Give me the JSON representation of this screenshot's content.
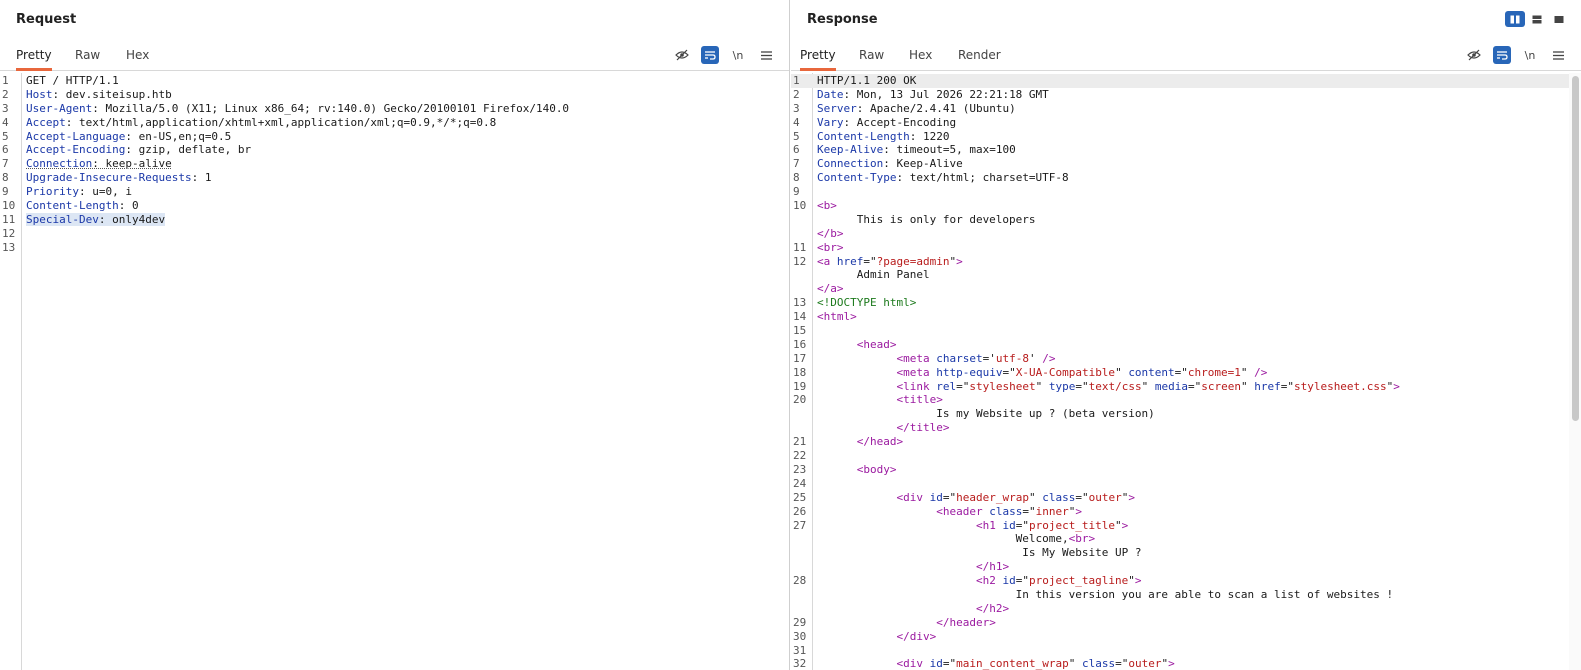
{
  "request": {
    "title": "Request",
    "tabs": [
      "Pretty",
      "Raw",
      "Hex"
    ],
    "active_tab": "Pretty",
    "lines": [
      {
        "n": "1",
        "segs": [
          {
            "t": "GET / HTTP/1.1",
            "c": ""
          }
        ]
      },
      {
        "n": "2",
        "segs": [
          {
            "t": "Host",
            "c": "hk"
          },
          {
            "t": ": dev.siteisup.htb",
            "c": ""
          }
        ]
      },
      {
        "n": "3",
        "segs": [
          {
            "t": "User-Agent",
            "c": "hk"
          },
          {
            "t": ": Mozilla/5.0 (X11; Linux x86_64; rv:140.0) Gecko/20100101 Firefox/140.0",
            "c": ""
          }
        ]
      },
      {
        "n": "4",
        "segs": [
          {
            "t": "Accept",
            "c": "hk"
          },
          {
            "t": ": text/html,application/xhtml+xml,application/xml;q=0.9,*/*;q=0.8",
            "c": ""
          }
        ]
      },
      {
        "n": "5",
        "segs": [
          {
            "t": "Accept-Language",
            "c": "hk"
          },
          {
            "t": ": en-US,en;q=0.5",
            "c": ""
          }
        ]
      },
      {
        "n": "6",
        "segs": [
          {
            "t": "Accept-Encoding",
            "c": "hk"
          },
          {
            "t": ": gzip, deflate, br",
            "c": ""
          }
        ]
      },
      {
        "n": "7",
        "segs": [
          {
            "t": "Connection",
            "c": "hk ul"
          },
          {
            "t": ": keep-alive",
            "c": "ul"
          }
        ]
      },
      {
        "n": "8",
        "segs": [
          {
            "t": "Upgrade-Insecure-Requests",
            "c": "hk"
          },
          {
            "t": ": 1",
            "c": ""
          }
        ]
      },
      {
        "n": "9",
        "segs": [
          {
            "t": "Priority",
            "c": "hk"
          },
          {
            "t": ": u=0, i",
            "c": ""
          }
        ]
      },
      {
        "n": "10",
        "segs": [
          {
            "t": "Content-Length",
            "c": "hk"
          },
          {
            "t": ": 0",
            "c": ""
          }
        ]
      },
      {
        "n": "11",
        "segs": [
          {
            "t": "Special-Dev",
            "c": "hk hl"
          },
          {
            "t": ": only4dev",
            "c": "hl"
          }
        ]
      },
      {
        "n": "12",
        "segs": []
      },
      {
        "n": "13",
        "segs": []
      }
    ]
  },
  "response": {
    "title": "Response",
    "tabs": [
      "Pretty",
      "Raw",
      "Hex",
      "Render"
    ],
    "active_tab": "Pretty",
    "lines": [
      {
        "n": "1",
        "cur": true,
        "segs": [
          {
            "t": "HTTP/1.1 200 OK",
            "c": ""
          }
        ]
      },
      {
        "n": "2",
        "segs": [
          {
            "t": "Date",
            "c": "hk"
          },
          {
            "t": ": Mon, 13 Jul 2026 22:21:18 GMT",
            "c": ""
          }
        ]
      },
      {
        "n": "3",
        "segs": [
          {
            "t": "Server",
            "c": "hk"
          },
          {
            "t": ": Apache/2.4.41 (Ubuntu)",
            "c": ""
          }
        ]
      },
      {
        "n": "4",
        "segs": [
          {
            "t": "Vary",
            "c": "hk"
          },
          {
            "t": ": Accept-Encoding",
            "c": ""
          }
        ]
      },
      {
        "n": "5",
        "segs": [
          {
            "t": "Content-Length",
            "c": "hk"
          },
          {
            "t": ": 1220",
            "c": ""
          }
        ]
      },
      {
        "n": "6",
        "segs": [
          {
            "t": "Keep-Alive",
            "c": "hk"
          },
          {
            "t": ": timeout=5, max=100",
            "c": ""
          }
        ]
      },
      {
        "n": "7",
        "segs": [
          {
            "t": "Connection",
            "c": "hk"
          },
          {
            "t": ": Keep-Alive",
            "c": ""
          }
        ]
      },
      {
        "n": "8",
        "segs": [
          {
            "t": "Content-Type",
            "c": "hk"
          },
          {
            "t": ": text/html; charset=UTF-8",
            "c": ""
          }
        ]
      },
      {
        "n": "9",
        "segs": []
      },
      {
        "n": "10",
        "segs": [
          {
            "t": "<b>",
            "c": "tag"
          }
        ]
      },
      {
        "n": "",
        "segs": [
          {
            "t": "      This is only for developers",
            "c": ""
          }
        ]
      },
      {
        "n": "",
        "segs": [
          {
            "t": "</b>",
            "c": "tag"
          }
        ]
      },
      {
        "n": "11",
        "segs": [
          {
            "t": "<br>",
            "c": "tag"
          }
        ]
      },
      {
        "n": "12",
        "segs": [
          {
            "t": "<a ",
            "c": "tag"
          },
          {
            "t": "href",
            "c": "attr"
          },
          {
            "t": "=\"",
            "c": ""
          },
          {
            "t": "?page=admin",
            "c": "val"
          },
          {
            "t": "\"",
            "c": ""
          },
          {
            "t": ">",
            "c": "tag"
          }
        ]
      },
      {
        "n": "",
        "segs": [
          {
            "t": "      Admin Panel",
            "c": ""
          }
        ]
      },
      {
        "n": "",
        "segs": [
          {
            "t": "</a>",
            "c": "tag"
          }
        ]
      },
      {
        "n": "13",
        "segs": [
          {
            "t": "<!DOCTYPE html>",
            "c": "dt"
          }
        ]
      },
      {
        "n": "14",
        "segs": [
          {
            "t": "<html>",
            "c": "tag"
          }
        ]
      },
      {
        "n": "15",
        "segs": []
      },
      {
        "n": "16",
        "segs": [
          {
            "t": "      ",
            "c": ""
          },
          {
            "t": "<head>",
            "c": "tag"
          }
        ]
      },
      {
        "n": "17",
        "segs": [
          {
            "t": "            ",
            "c": ""
          },
          {
            "t": "<meta ",
            "c": "tag"
          },
          {
            "t": "charset",
            "c": "attr"
          },
          {
            "t": "='",
            "c": ""
          },
          {
            "t": "utf-8",
            "c": "val"
          },
          {
            "t": "' ",
            "c": ""
          },
          {
            "t": "/>",
            "c": "tag"
          }
        ]
      },
      {
        "n": "18",
        "segs": [
          {
            "t": "            ",
            "c": ""
          },
          {
            "t": "<meta ",
            "c": "tag"
          },
          {
            "t": "http-equiv",
            "c": "attr"
          },
          {
            "t": "=\"",
            "c": ""
          },
          {
            "t": "X-UA-Compatible",
            "c": "val"
          },
          {
            "t": "\" ",
            "c": ""
          },
          {
            "t": "content",
            "c": "attr"
          },
          {
            "t": "=\"",
            "c": ""
          },
          {
            "t": "chrome=1",
            "c": "val"
          },
          {
            "t": "\" ",
            "c": ""
          },
          {
            "t": "/>",
            "c": "tag"
          }
        ]
      },
      {
        "n": "19",
        "segs": [
          {
            "t": "            ",
            "c": ""
          },
          {
            "t": "<link ",
            "c": "tag"
          },
          {
            "t": "rel",
            "c": "attr"
          },
          {
            "t": "=\"",
            "c": ""
          },
          {
            "t": "stylesheet",
            "c": "val"
          },
          {
            "t": "\" ",
            "c": ""
          },
          {
            "t": "type",
            "c": "attr"
          },
          {
            "t": "=\"",
            "c": ""
          },
          {
            "t": "text/css",
            "c": "val"
          },
          {
            "t": "\" ",
            "c": ""
          },
          {
            "t": "media",
            "c": "attr"
          },
          {
            "t": "=\"",
            "c": ""
          },
          {
            "t": "screen",
            "c": "val"
          },
          {
            "t": "\" ",
            "c": ""
          },
          {
            "t": "href",
            "c": "attr"
          },
          {
            "t": "=\"",
            "c": ""
          },
          {
            "t": "stylesheet.css",
            "c": "val"
          },
          {
            "t": "\"",
            "c": ""
          },
          {
            "t": ">",
            "c": "tag"
          }
        ]
      },
      {
        "n": "20",
        "segs": [
          {
            "t": "            ",
            "c": ""
          },
          {
            "t": "<title>",
            "c": "tag"
          }
        ]
      },
      {
        "n": "",
        "segs": [
          {
            "t": "                  Is my Website up ? (beta version)",
            "c": ""
          }
        ]
      },
      {
        "n": "",
        "segs": [
          {
            "t": "            ",
            "c": ""
          },
          {
            "t": "</title>",
            "c": "tag"
          }
        ]
      },
      {
        "n": "21",
        "segs": [
          {
            "t": "      ",
            "c": ""
          },
          {
            "t": "</head>",
            "c": "tag"
          }
        ]
      },
      {
        "n": "22",
        "segs": []
      },
      {
        "n": "23",
        "segs": [
          {
            "t": "      ",
            "c": ""
          },
          {
            "t": "<body>",
            "c": "tag"
          }
        ]
      },
      {
        "n": "24",
        "segs": []
      },
      {
        "n": "25",
        "segs": [
          {
            "t": "            ",
            "c": ""
          },
          {
            "t": "<div ",
            "c": "tag"
          },
          {
            "t": "id",
            "c": "attr"
          },
          {
            "t": "=\"",
            "c": ""
          },
          {
            "t": "header_wrap",
            "c": "val"
          },
          {
            "t": "\" ",
            "c": ""
          },
          {
            "t": "class",
            "c": "attr"
          },
          {
            "t": "=\"",
            "c": ""
          },
          {
            "t": "outer",
            "c": "val"
          },
          {
            "t": "\"",
            "c": ""
          },
          {
            "t": ">",
            "c": "tag"
          }
        ]
      },
      {
        "n": "26",
        "segs": [
          {
            "t": "                  ",
            "c": ""
          },
          {
            "t": "<header ",
            "c": "tag"
          },
          {
            "t": "class",
            "c": "attr"
          },
          {
            "t": "=\"",
            "c": ""
          },
          {
            "t": "inner",
            "c": "val"
          },
          {
            "t": "\"",
            "c": ""
          },
          {
            "t": ">",
            "c": "tag"
          }
        ]
      },
      {
        "n": "27",
        "segs": [
          {
            "t": "                        ",
            "c": ""
          },
          {
            "t": "<h1 ",
            "c": "tag"
          },
          {
            "t": "id",
            "c": "attr"
          },
          {
            "t": "=\"",
            "c": ""
          },
          {
            "t": "project_title",
            "c": "val"
          },
          {
            "t": "\"",
            "c": ""
          },
          {
            "t": ">",
            "c": "tag"
          }
        ]
      },
      {
        "n": "",
        "segs": [
          {
            "t": "                              Welcome,",
            "c": ""
          },
          {
            "t": "<br>",
            "c": "tag"
          }
        ]
      },
      {
        "n": "",
        "segs": [
          {
            "t": "                               Is My Website UP ?",
            "c": ""
          }
        ]
      },
      {
        "n": "",
        "segs": [
          {
            "t": "                        ",
            "c": ""
          },
          {
            "t": "</h1>",
            "c": "tag"
          }
        ]
      },
      {
        "n": "28",
        "segs": [
          {
            "t": "                        ",
            "c": ""
          },
          {
            "t": "<h2 ",
            "c": "tag"
          },
          {
            "t": "id",
            "c": "attr"
          },
          {
            "t": "=\"",
            "c": ""
          },
          {
            "t": "project_tagline",
            "c": "val"
          },
          {
            "t": "\"",
            "c": ""
          },
          {
            "t": ">",
            "c": "tag"
          }
        ]
      },
      {
        "n": "",
        "segs": [
          {
            "t": "                              In this version you are able to scan a list of websites !",
            "c": ""
          }
        ]
      },
      {
        "n": "",
        "segs": [
          {
            "t": "                        ",
            "c": ""
          },
          {
            "t": "</h2>",
            "c": "tag"
          }
        ]
      },
      {
        "n": "29",
        "segs": [
          {
            "t": "                  ",
            "c": ""
          },
          {
            "t": "</header>",
            "c": "tag"
          }
        ]
      },
      {
        "n": "30",
        "segs": [
          {
            "t": "            ",
            "c": ""
          },
          {
            "t": "</div>",
            "c": "tag"
          }
        ]
      },
      {
        "n": "31",
        "segs": []
      },
      {
        "n": "32",
        "segs": [
          {
            "t": "            ",
            "c": ""
          },
          {
            "t": "<div ",
            "c": "tag"
          },
          {
            "t": "id",
            "c": "attr"
          },
          {
            "t": "=\"",
            "c": ""
          },
          {
            "t": "main_content_wrap",
            "c": "val"
          },
          {
            "t": "\" ",
            "c": ""
          },
          {
            "t": "class",
            "c": "attr"
          },
          {
            "t": "=\"",
            "c": ""
          },
          {
            "t": "outer",
            "c": "val"
          },
          {
            "t": "\"",
            "c": ""
          },
          {
            "t": ">",
            "c": "tag"
          }
        ]
      }
    ]
  },
  "icons": {
    "hide": "eye-slash-icon",
    "wrap": "word-wrap-icon",
    "newline": "\\n",
    "menu": "hamburger-menu-icon"
  },
  "colors": {
    "accent": "#e8673c",
    "toggle_blue": "#2866b8",
    "header_key": "#1b38a8",
    "tag": "#9b1aa0",
    "attr_value": "#b81c1c",
    "doctype": "#1d7a1d"
  }
}
